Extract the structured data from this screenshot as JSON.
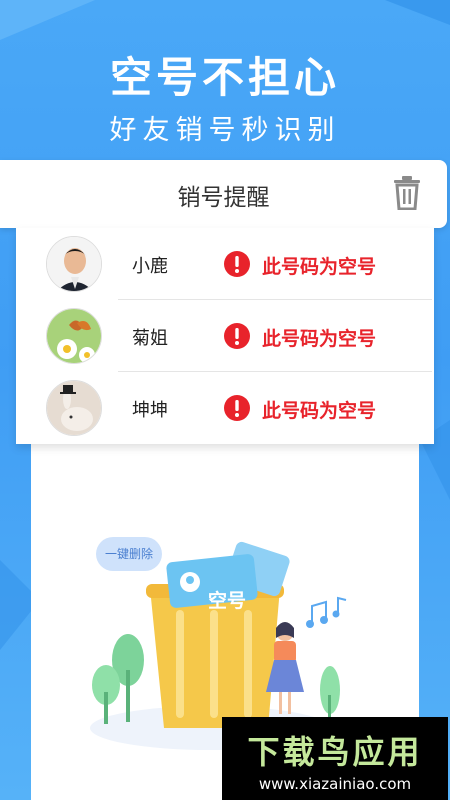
{
  "hero": {
    "title": "空号不担心",
    "subtitle": "好友销号秒识别"
  },
  "header": {
    "title": "销号提醒",
    "trash_icon": "trash-icon"
  },
  "contacts": [
    {
      "name": "小鹿",
      "status": "此号码为空号",
      "avatar": "avatar-man-in-suit"
    },
    {
      "name": "菊姐",
      "status": "此号码为空号",
      "avatar": "avatar-butterfly-daisy"
    },
    {
      "name": "坤坤",
      "status": "此号码为空号",
      "avatar": "avatar-rabbit-top-hat"
    }
  ],
  "illustration": {
    "bubble_text": "一键删除",
    "card_text": "空号",
    "music_icon": "music-note-icon"
  },
  "watermark": {
    "title": "下载鸟应用",
    "url": "www.xiazainiao.com"
  },
  "colors": {
    "background": "#4aa8f7",
    "alert_red": "#e8232b",
    "trash_gray": "#8a8a8a"
  }
}
